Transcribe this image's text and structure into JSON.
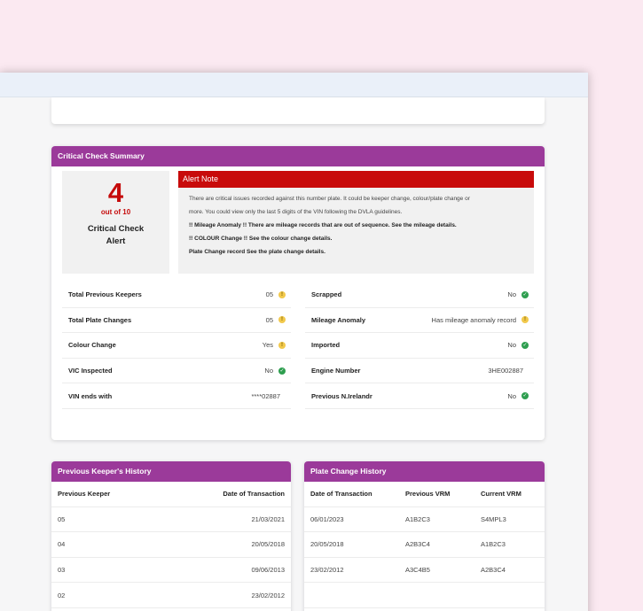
{
  "summary": {
    "title": "Critical Check Summary",
    "alert_count": "4",
    "alert_out_of": "out of 10",
    "alert_label": "Critical Check Alert",
    "note_title": "Alert Note",
    "note_lines": [
      "There are critical issues recorded against this number plate. It could be keeper change, colour/plate change or",
      "more. You could view only the last 5 digits of the VIN following the DVLA guidelines.",
      "!! Mileage Anomaly !! There are mileage records that are out of sequence. See the mileage details.",
      "!! COLOUR Change !! See the colour change details.",
      "Plate Change record See the plate change details."
    ],
    "left_rows": [
      {
        "label": "Total Previous Keepers",
        "value": "05",
        "status": "warning-icon"
      },
      {
        "label": "Total Plate Changes",
        "value": "05",
        "status": "warning-icon"
      },
      {
        "label": "Colour Change",
        "value": "Yes",
        "status": "warning-icon"
      },
      {
        "label": "VIC Inspected",
        "value": "No",
        "status": "check-icon"
      },
      {
        "label": "VIN ends with",
        "value": "****02887",
        "status": ""
      }
    ],
    "right_rows": [
      {
        "label": "Scrapped",
        "value": "No",
        "status": "check-icon"
      },
      {
        "label": "Mileage Anomaly",
        "value": "Has mileage anomaly record",
        "status": "warning-icon"
      },
      {
        "label": "Imported",
        "value": "No",
        "status": "check-icon"
      },
      {
        "label": "Engine Number",
        "value": "3HE002887",
        "status": ""
      },
      {
        "label": "Previous N.Irelandr",
        "value": "No",
        "status": "check-icon"
      }
    ]
  },
  "keeper_history": {
    "title": "Previous Keeper's History",
    "col_keeper": "Previous Keeper",
    "col_date": "Date of Transaction",
    "rows": [
      {
        "keeper": "05",
        "date": "21/03/2021"
      },
      {
        "keeper": "04",
        "date": "20/05/2018"
      },
      {
        "keeper": "03",
        "date": "09/06/2013"
      },
      {
        "keeper": "02",
        "date": "23/02/2012"
      }
    ]
  },
  "plate_history": {
    "title": "Plate Change History",
    "col_date": "Date of Transaction",
    "col_prev": "Previous VRM",
    "col_curr": "Current VRM",
    "rows": [
      {
        "date": "06/01/2023",
        "prev": "A1B2C3",
        "curr": "S4MPL3"
      },
      {
        "date": "20/05/2018",
        "prev": "A2B3C4",
        "curr": "A1B2C3"
      },
      {
        "date": "23/02/2012",
        "prev": "A3C4B5",
        "curr": "A2B3C4"
      },
      {
        "date": "",
        "prev": "",
        "curr": ""
      }
    ]
  },
  "colors": {
    "header_purple": "#9b3a9a",
    "alert_red": "#c80b0b",
    "warning": "#f2c94c",
    "ok": "#2e9e4f",
    "background": "#fbe9f1"
  }
}
